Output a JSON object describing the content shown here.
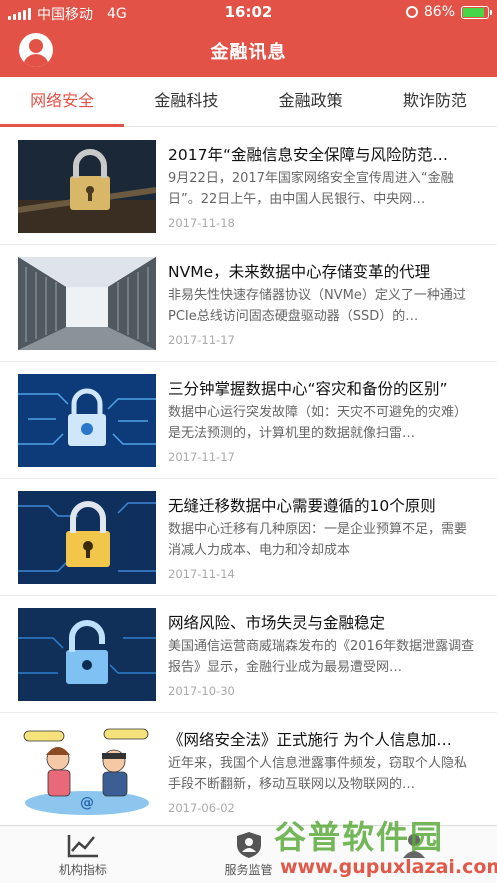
{
  "status_bar": {
    "carrier": "中国移动",
    "network": "4G",
    "time": "16:02",
    "battery": "86%",
    "battery_level": 0.86,
    "battery_color": "#45d64a"
  },
  "header": {
    "title": "金融讯息",
    "avatar_icon": "user-avatar-icon",
    "brand_color": "#e25246"
  },
  "tabs": [
    {
      "label": "网络安全",
      "active": true
    },
    {
      "label": "金融科技",
      "active": false
    },
    {
      "label": "金融政策",
      "active": false
    },
    {
      "label": "欺诈防范",
      "active": false
    }
  ],
  "news": [
    {
      "title": "2017年“金融信息安全保障与风险防范…",
      "desc": "9月22日，2017年国家网络安全宣传周进入“金融日”。22日上午，由中国人民银行、中央网…",
      "date": "2017-11-18"
    },
    {
      "title": "NVMe，未来数据中心存储变革的代理",
      "desc": "非易失性快速存储器协议（NVMe）定义了一种通过PCIe总线访问固态硬盘驱动器（SSD）的…",
      "date": "2017-11-17"
    },
    {
      "title": "三分钟掌握数据中心“容灾和备份的区别”",
      "desc": "数据中心运行突发故障（如：天灾不可避免的灾难）是无法预测的，计算机里的数据就像扫雷…",
      "date": "2017-11-17"
    },
    {
      "title": "无缝迁移数据中心需要遵循的10个原则",
      "desc": "数据中心迁移有几种原因：一是企业预算不足，需要消减人力成本、电力和冷却成本",
      "date": "2017-11-14"
    },
    {
      "title": "网络风险、市场失灵与金融稳定",
      "desc": "美国通信运营商威瑞森发布的《2016年数据泄露调查报告》显示，金融行业成为最易遭受网…",
      "date": "2017-10-30"
    },
    {
      "title": "《网络安全法》正式施行 为个人信息加…",
      "desc": "近年来，我国个人信息泄露事件频发，窃取个人隐私手段不断翻新，移动互联网以及物联网的…",
      "date": "2017-06-02"
    }
  ],
  "bottom_nav": [
    {
      "label": "机构指标",
      "icon": "trend-chart-icon"
    },
    {
      "label": "服务监管",
      "icon": "shield-user-icon"
    },
    {
      "label": "",
      "icon": "person-icon"
    }
  ],
  "watermark": {
    "text": "谷普软件园",
    "url": "www.gupuxlazai.com"
  }
}
